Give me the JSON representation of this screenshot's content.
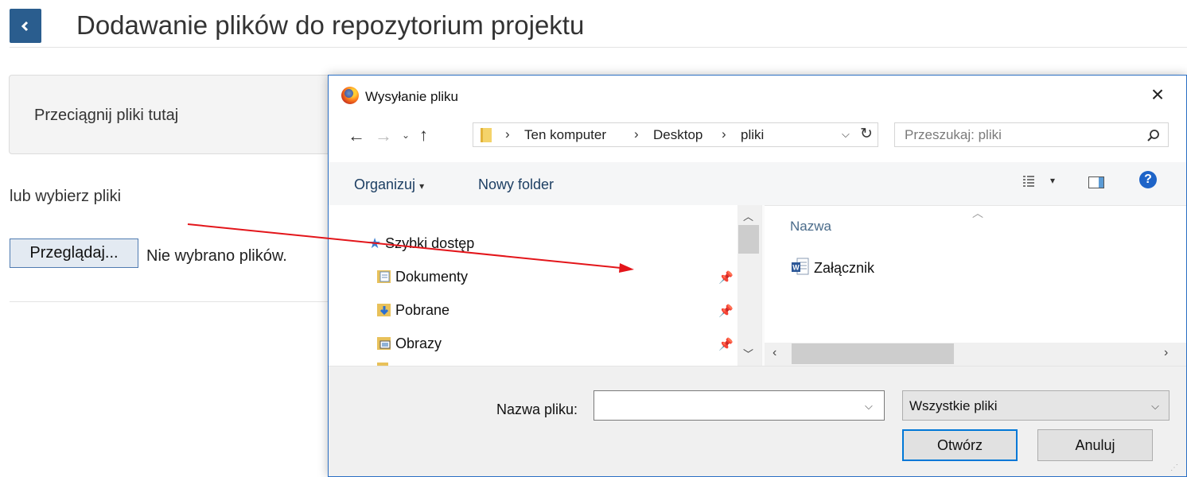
{
  "page": {
    "title": "Dodawanie plików do repozytorium projektu",
    "dropzone_text": "Przeciągnij pliki tutaj",
    "or_text": "lub wybierz pliki",
    "browse_label": "Przeglądaj...",
    "no_files_text": "Nie wybrano plików."
  },
  "dialog": {
    "title": "Wysyłanie pliku",
    "breadcrumb": [
      "Ten komputer",
      "Desktop",
      "pliki"
    ],
    "search_placeholder": "Przeszukaj: pliki",
    "toolbar": {
      "organize_label": "Organizuj",
      "new_folder_label": "Nowy folder"
    },
    "nav_tree": [
      {
        "label": "Szybki dostęp",
        "icon": "star-icon",
        "pinned": false
      },
      {
        "label": "Dokumenty",
        "icon": "documents-folder-icon",
        "pinned": true
      },
      {
        "label": "Pobrane",
        "icon": "downloads-folder-icon",
        "pinned": true
      },
      {
        "label": "Obrazy",
        "icon": "pictures-folder-icon",
        "pinned": true
      }
    ],
    "column_header": "Nazwa",
    "files": [
      {
        "name": "Załącznik",
        "icon": "word-document-icon"
      }
    ],
    "filename_label": "Nazwa pliku:",
    "filename_value": "",
    "filetype_value": "Wszystkie pliki",
    "open_label": "Otwórz",
    "cancel_label": "Anuluj"
  },
  "colors": {
    "back_button": "#2a5d8e",
    "annotation_arrow": "#e3151a",
    "dialog_border": "#2b6fc4",
    "help_icon": "#1e64c8"
  }
}
